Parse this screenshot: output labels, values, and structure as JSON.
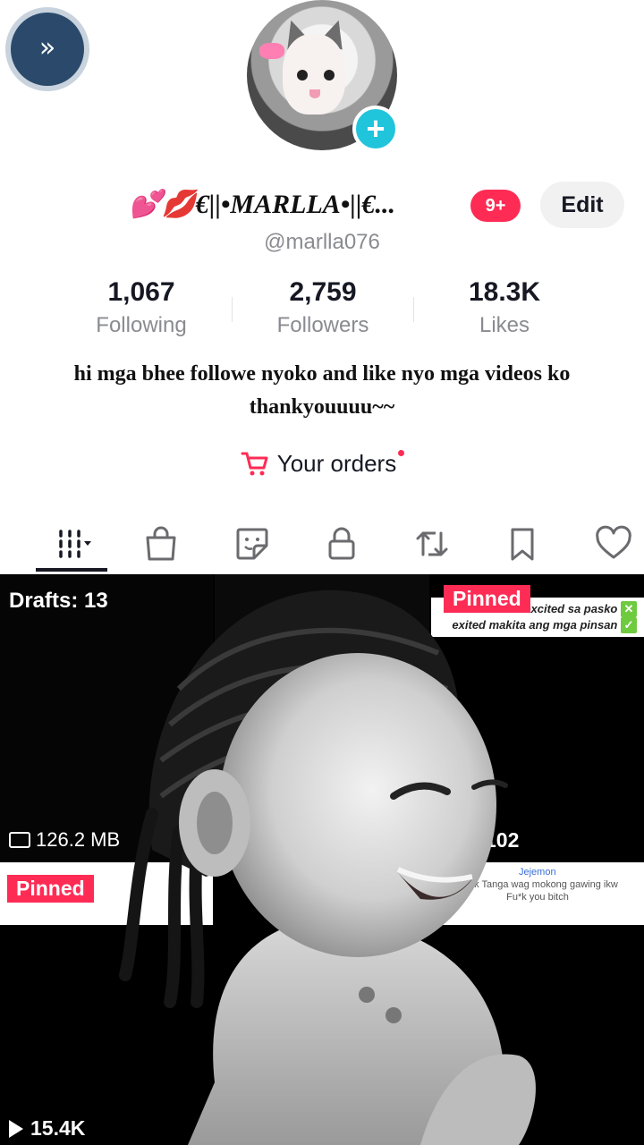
{
  "header": {
    "expand_icon": "double-chevron-right-icon",
    "display_name": "💕💋€||•MARLLA•||€...",
    "notification_badge": "9+",
    "edit_label": "Edit",
    "handle": "@marlla076"
  },
  "stats": [
    {
      "value": "1,067",
      "label": "Following"
    },
    {
      "value": "2,759",
      "label": "Followers"
    },
    {
      "value": "18.3K",
      "label": "Likes"
    }
  ],
  "bio": "hi mga bhee followe nyoko and like nyo mga videos ko thankyouuuu~~",
  "orders": {
    "label": "Your orders"
  },
  "tabs": [
    {
      "icon": "videos-grid-icon",
      "selected": true
    },
    {
      "icon": "shopping-bag-icon"
    },
    {
      "icon": "sticker-icon"
    },
    {
      "icon": "lock-icon"
    },
    {
      "icon": "repost-icon"
    },
    {
      "icon": "bookmark-icon"
    },
    {
      "icon": "heart-icon"
    }
  ],
  "grid": {
    "drafts": {
      "label": "Drafts: 13",
      "size": "126.2 MB"
    },
    "pinned_1": {
      "label": "Pinned",
      "caption_line1": "excited sa pasko",
      "caption_line2": "exited makita ang mga pinsan",
      "views": "102"
    },
    "pinned_2": {
      "label": "Pinned",
      "views": "15.4K"
    },
    "caption_3": {
      "name": "Jejemon",
      "line1": "Hskk Tanga wag mokong gawing ikw",
      "line2": "Fu*k you bitch"
    }
  },
  "colors": {
    "accent": "#fe2c55",
    "add_button": "#20c4db",
    "muted": "#8a8b91"
  }
}
